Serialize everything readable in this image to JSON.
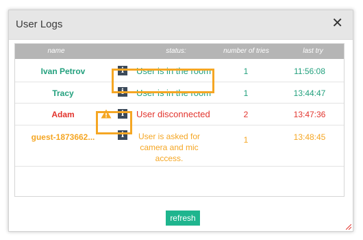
{
  "dialog": {
    "title": "User Logs",
    "close_icon": "close-icon"
  },
  "table": {
    "headers": {
      "name": "name",
      "status": "status:",
      "tries": "number of tries",
      "last_try": "last try"
    },
    "rows": [
      {
        "name": "Ivan Petrov",
        "status": "User is in the room",
        "tries": "1",
        "last_try": "11:56:08",
        "color": "#22a07d",
        "warning": false
      },
      {
        "name": "Tracy",
        "status": "User is in the room",
        "tries": "1",
        "last_try": "13:44:47",
        "color": "#22a07d",
        "warning": false
      },
      {
        "name": "Adam",
        "status": "User disconnected",
        "tries": "2",
        "last_try": "13:47:36",
        "color": "#e2332c",
        "warning": true
      },
      {
        "name": "guest-1873662...",
        "status": "User is asked for camera and mic access.",
        "tries": "1",
        "last_try": "13:48:45",
        "color": "#f5a623",
        "warning": false
      }
    ],
    "info_icon_glyph": "i"
  },
  "actions": {
    "refresh_label": "refresh"
  },
  "colors": {
    "accent": "#1fb58e",
    "highlight": "#f5a623",
    "header_bg": "#b5b5b5"
  }
}
